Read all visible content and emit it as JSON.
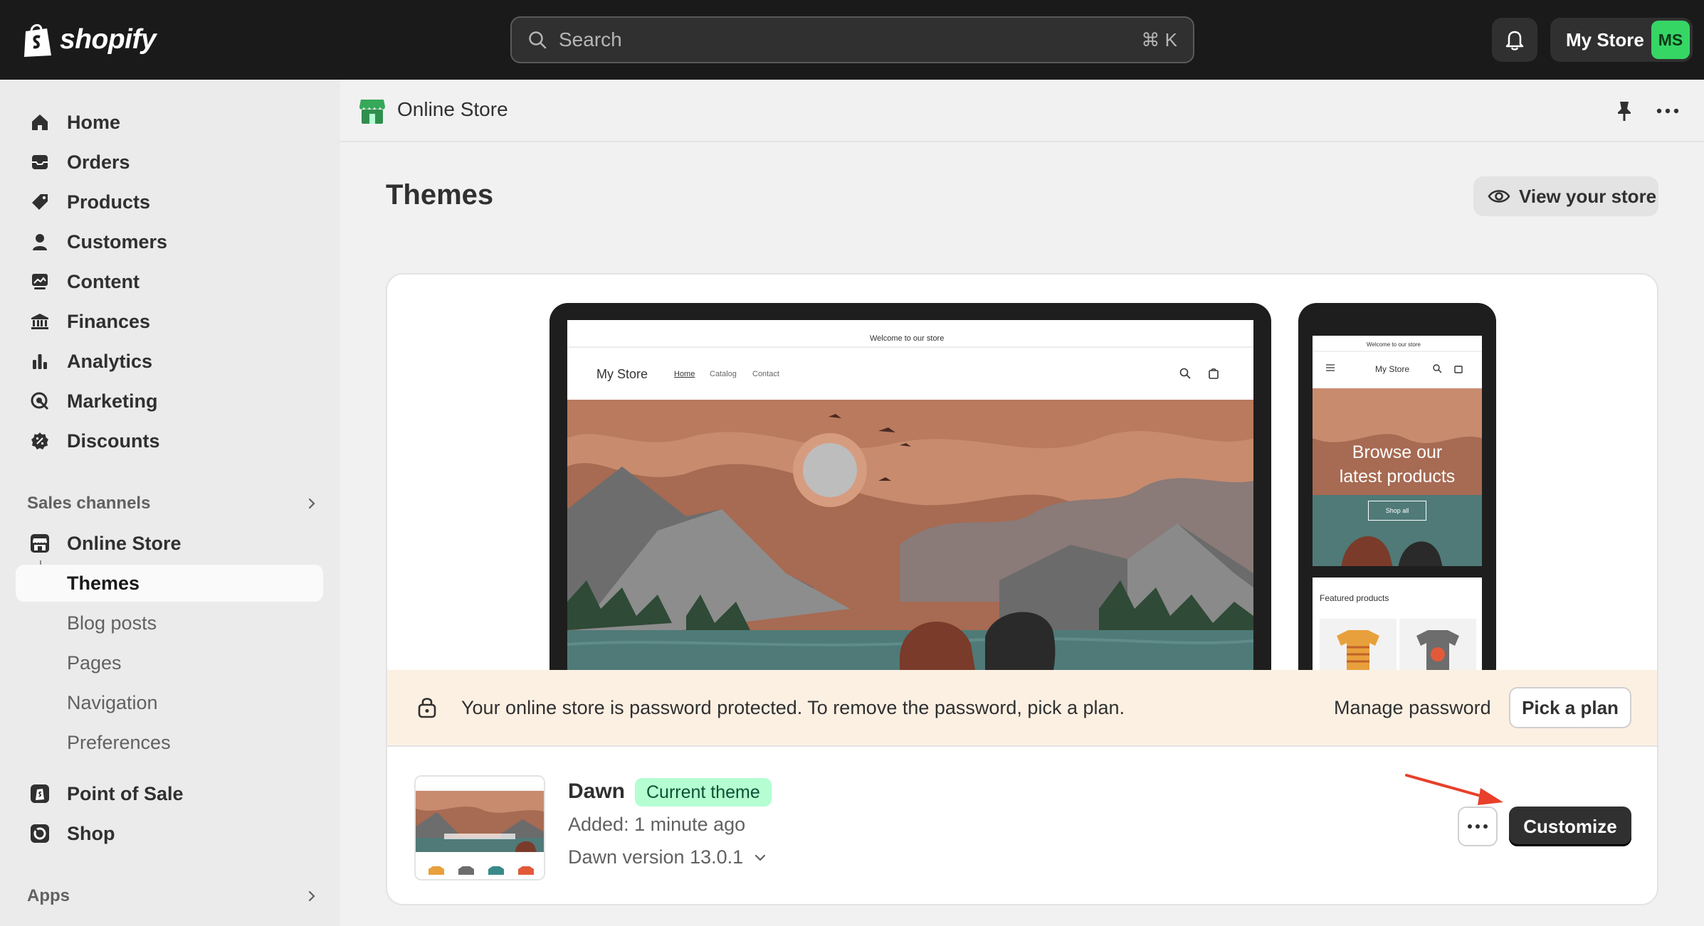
{
  "topbar": {
    "logo_text": "shopify",
    "search_placeholder": "Search",
    "search_shortcut": "⌘ K",
    "store_name": "My Store",
    "avatar_initials": "MS"
  },
  "sidebar": {
    "items": [
      {
        "label": "Home",
        "icon": "home-icon"
      },
      {
        "label": "Orders",
        "icon": "orders-icon"
      },
      {
        "label": "Products",
        "icon": "tag-icon"
      },
      {
        "label": "Customers",
        "icon": "person-icon"
      },
      {
        "label": "Content",
        "icon": "content-icon"
      },
      {
        "label": "Finances",
        "icon": "bank-icon"
      },
      {
        "label": "Analytics",
        "icon": "bar-chart-icon"
      },
      {
        "label": "Marketing",
        "icon": "target-icon"
      },
      {
        "label": "Discounts",
        "icon": "discount-icon"
      }
    ],
    "sales_channels_label": "Sales channels",
    "online_store_label": "Online Store",
    "sub_items": [
      "Themes",
      "Blog posts",
      "Pages",
      "Navigation",
      "Preferences"
    ],
    "pos_label": "Point of Sale",
    "shop_label": "Shop",
    "apps_label": "Apps"
  },
  "header": {
    "app_name": "Online Store"
  },
  "page": {
    "title": "Themes",
    "view_store_label": "View your store"
  },
  "preview": {
    "desktop": {
      "announcement": "Welcome to our store",
      "store_name": "My Store",
      "nav": [
        "Home",
        "Catalog",
        "Contact"
      ]
    },
    "mobile": {
      "announcement": "Welcome to our store",
      "store_name": "My Store",
      "hero_line1": "Browse our",
      "hero_line2": "latest products",
      "hero_button": "Shop all",
      "featured": "Featured products"
    }
  },
  "banner": {
    "text": "Your online store is password protected. To remove the password, pick a plan.",
    "manage_label": "Manage password",
    "plan_label": "Pick a plan"
  },
  "theme": {
    "name": "Dawn",
    "badge": "Current theme",
    "added": "Added: 1 minute ago",
    "version": "Dawn version 13.0.1",
    "customize_label": "Customize"
  },
  "colors": {
    "topbar_bg": "#1a1a1a",
    "avatar_bg": "#36d665",
    "badge_bg": "#b4fed2",
    "banner_bg": "#fcf0e3",
    "primary_btn": "#303030",
    "annotation_arrow": "#e8402a"
  }
}
